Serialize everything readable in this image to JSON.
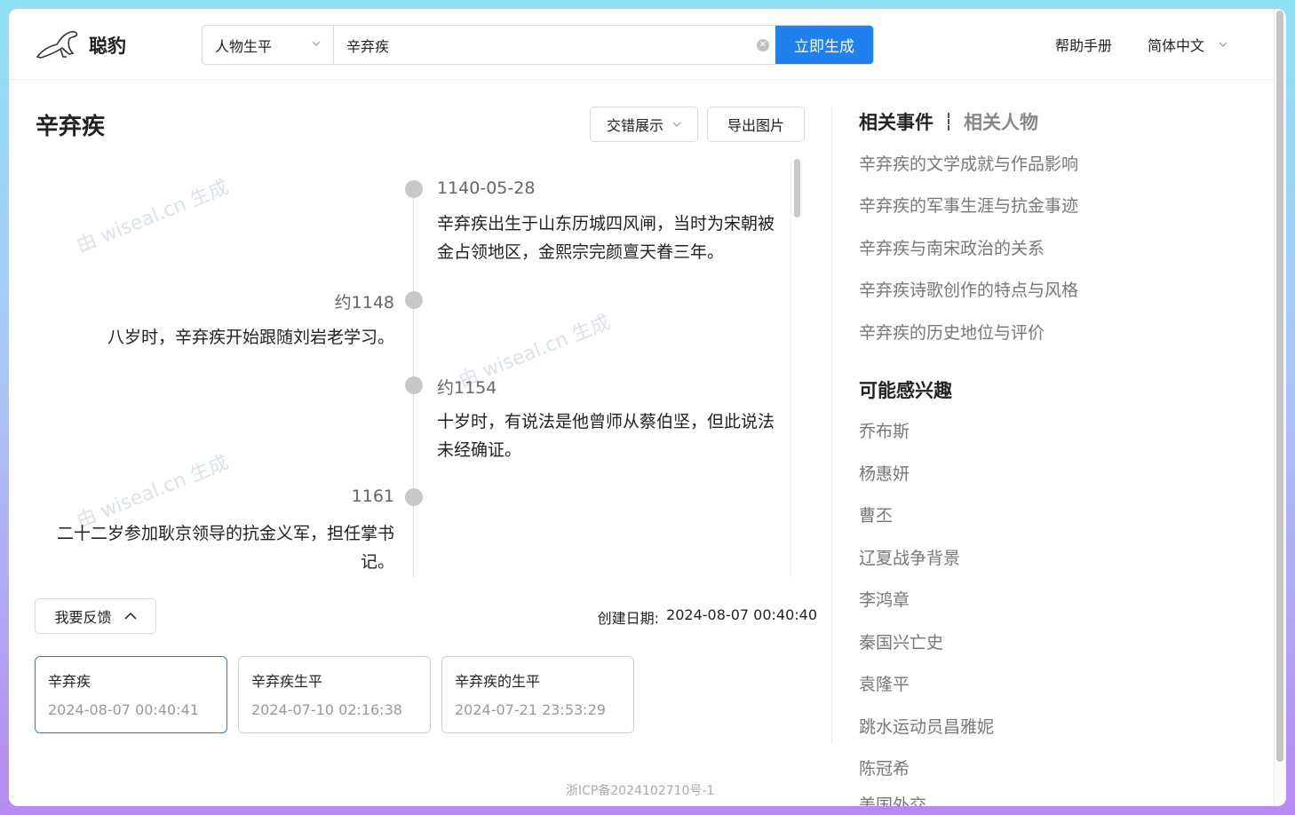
{
  "app": {
    "name": "聪豹"
  },
  "search": {
    "type_selected": "人物生平",
    "query": "辛弃疾",
    "generate_label": "立即生成"
  },
  "nav": {
    "help": "帮助手册",
    "language": "简体中文"
  },
  "main": {
    "title": "辛弃疾",
    "layout_mode": "交错展示",
    "export_label": "导出图片",
    "watermark": "由 wiseal.cn 生成",
    "timeline": [
      {
        "date": "1140-05-28",
        "text": "辛弃疾出生于山东历城四风闸，当时为宋朝被金占领地区，金熙宗完颜亶天眷三年。",
        "side": "right"
      },
      {
        "date": "约1148",
        "text": "八岁时，辛弃疾开始跟随刘岩老学习。",
        "side": "left"
      },
      {
        "date": "约1154",
        "text": "十岁时，有说法是他曾师从蔡伯坚，但此说法未经确证。",
        "side": "right"
      },
      {
        "date": "1161",
        "text": "二十二岁参加耿京领导的抗金义军，担任掌书记。",
        "side": "left"
      }
    ],
    "feedback_label": "我要反馈",
    "created_label": "创建日期:",
    "created_value": "2024-08-07 00:40:40"
  },
  "history": [
    {
      "title": "辛弃疾",
      "time": "2024-08-07 00:40:41",
      "active": true
    },
    {
      "title": "辛弃疾生平",
      "time": "2024-07-10 02:16:38",
      "active": false
    },
    {
      "title": "辛弃疾的生平",
      "time": "2024-07-21 23:53:29",
      "active": false
    }
  ],
  "sidebar": {
    "tab_events": "相关事件",
    "tab_people": "相关人物",
    "events": [
      "辛弃疾的文学成就与作品影响",
      "辛弃疾的军事生涯与抗金事迹",
      "辛弃疾与南宋政治的关系",
      "辛弃疾诗歌创作的特点与风格",
      "辛弃疾的历史地位与评价"
    ],
    "interest_title": "可能感兴趣",
    "interests": [
      "乔布斯",
      "杨惠妍",
      "曹丕",
      "辽夏战争背景",
      "李鸿章",
      "秦国兴亡史",
      "袁隆平",
      "跳水运动员昌雅妮",
      "陈冠希",
      "美国外交"
    ]
  },
  "footer": {
    "icp": "浙ICP备2024102710号-1"
  },
  "colors": {
    "accent": "#1f80f0",
    "active_border": "#2a7ae2",
    "muted": "#777777"
  }
}
